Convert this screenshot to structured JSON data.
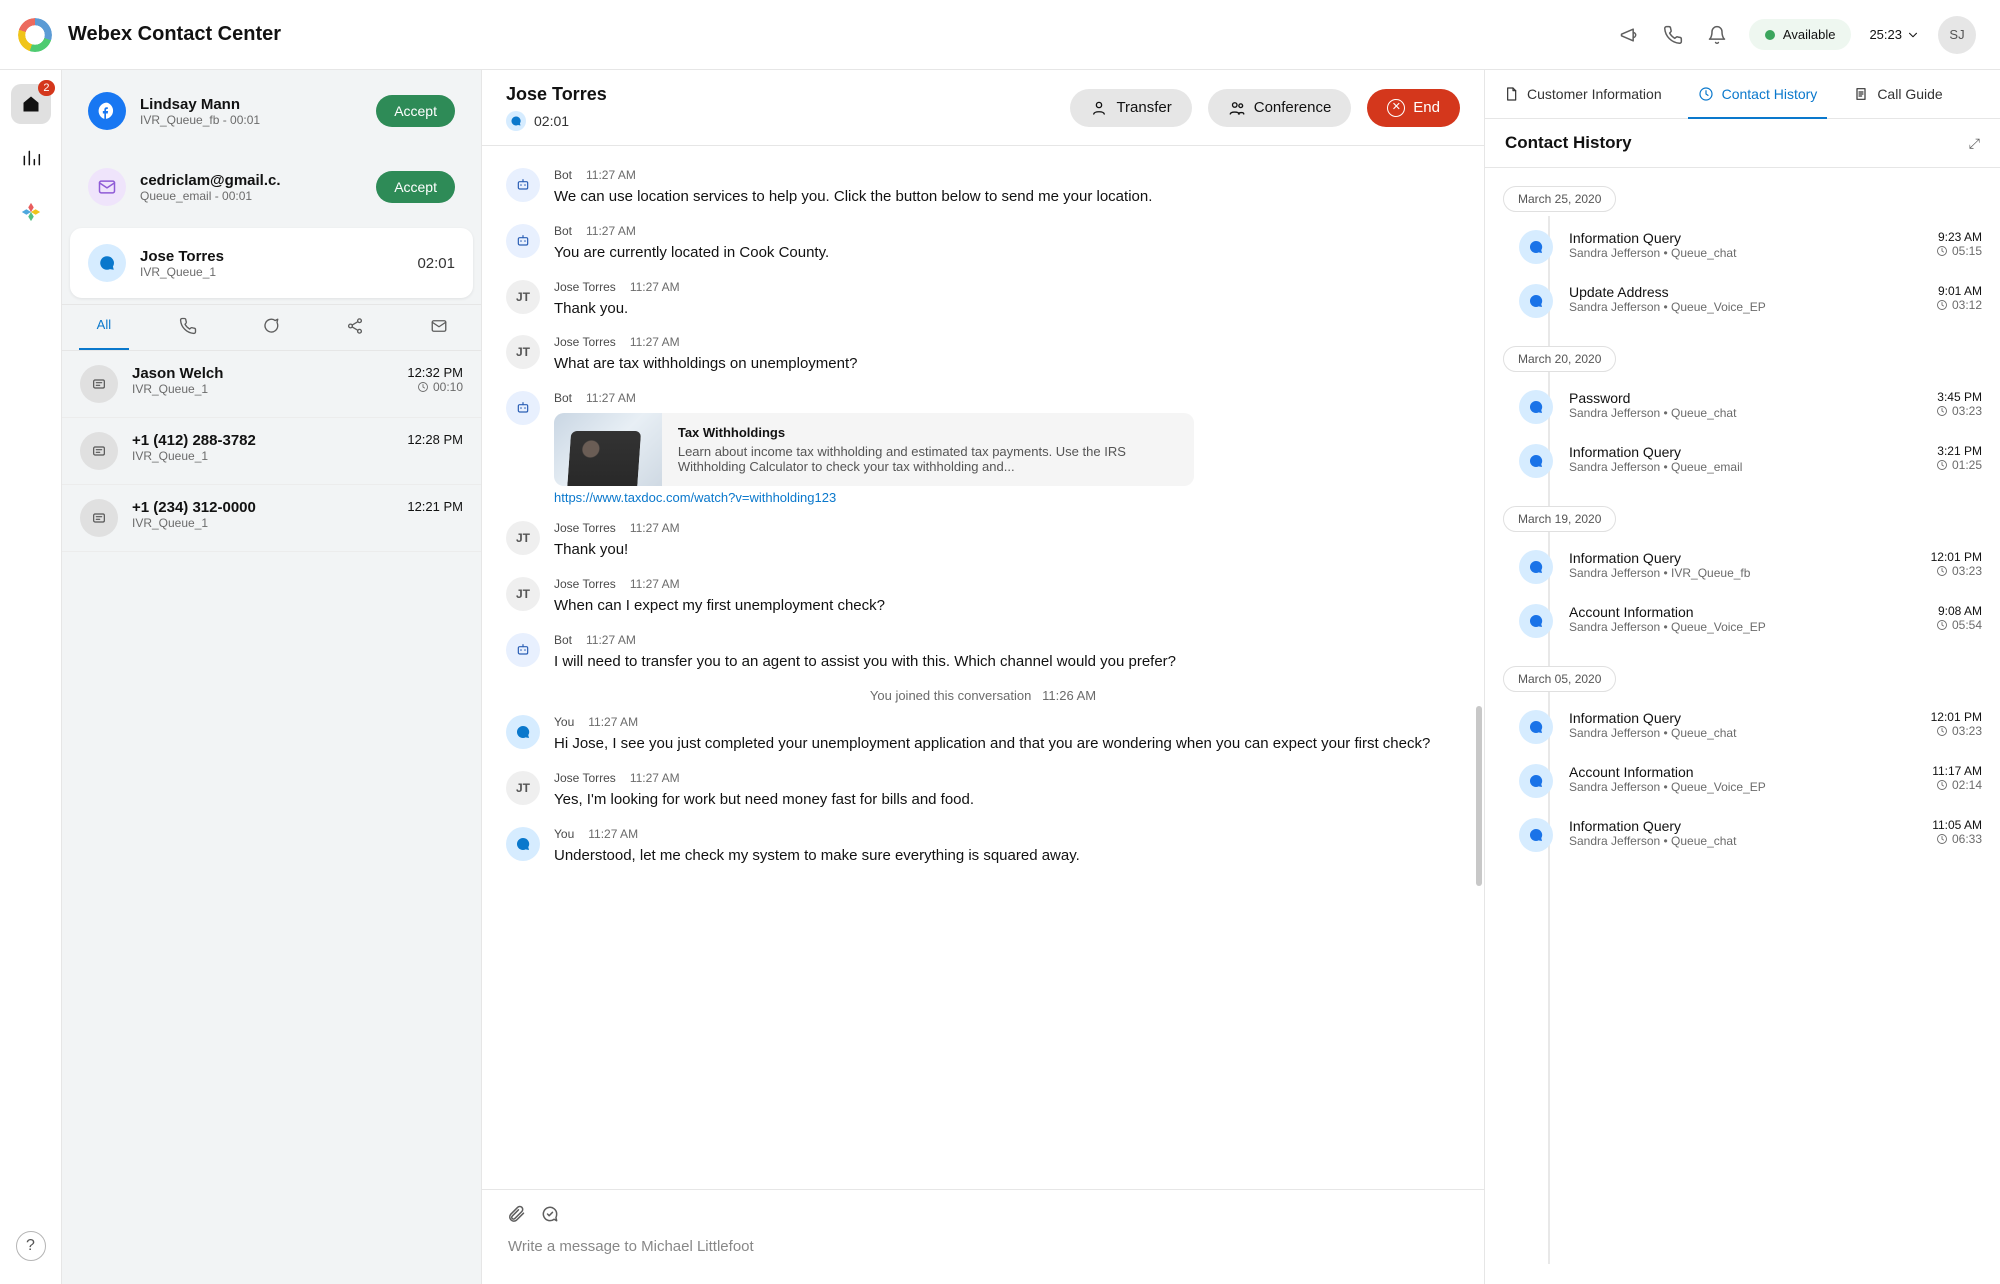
{
  "header": {
    "app_title": "Webex Contact Center",
    "status_label": "Available",
    "session_timer": "25:23",
    "user_initials": "SJ"
  },
  "rail": {
    "home_badge": "2"
  },
  "queue": {
    "items": [
      {
        "name": "Lindsay Mann",
        "sub": "IVR_Queue_fb - 00:01",
        "channel": "fb",
        "action": "Accept"
      },
      {
        "name": "cedriclam@gmail.c.",
        "sub": "Queue_email - 00:01",
        "channel": "email",
        "action": "Accept"
      },
      {
        "name": "Jose Torres",
        "sub": "IVR_Queue_1",
        "channel": "chat",
        "timer": "02:01",
        "selected": true
      }
    ],
    "history_tabs": {
      "active": "All"
    },
    "history": [
      {
        "name": "Jason Welch",
        "sub": "IVR_Queue_1",
        "time": "12:32 PM",
        "dur": "00:10"
      },
      {
        "name": "+1 (412) 288-3782",
        "sub": "IVR_Queue_1",
        "time": "12:28 PM"
      },
      {
        "name": "+1 (234) 312-0000",
        "sub": "IVR_Queue_1",
        "time": "12:21 PM"
      }
    ]
  },
  "conversation": {
    "title": "Jose Torres",
    "timer": "02:01",
    "buttons": {
      "transfer": "Transfer",
      "conference": "Conference",
      "end": "End"
    },
    "compose_placeholder": "Write a message to Michael Littlefoot",
    "system_note_text": "You joined this conversation",
    "system_note_time": "11:26 AM",
    "card": {
      "title": "Tax Withholdings",
      "desc": "Learn about income tax withholding and estimated tax payments. Use the IRS Withholding Calculator to check your tax withholding and...",
      "link": "https://www.taxdoc.com/watch?v=withholding123"
    },
    "messages": [
      {
        "sender": "Bot",
        "time": "11:27 AM",
        "avatar": "bot",
        "text": "We can use location services to help you.  Click the button below to send me your location."
      },
      {
        "sender": "Bot",
        "time": "11:27 AM",
        "avatar": "bot",
        "text": "You are currently located in Cook County."
      },
      {
        "sender": "Jose Torres",
        "time": "11:27 AM",
        "avatar": "jt",
        "text": "Thank you."
      },
      {
        "sender": "Jose Torres",
        "time": "11:27 AM",
        "avatar": "jt",
        "text": "What are tax withholdings on unemployment?"
      },
      {
        "sender": "Bot",
        "time": "11:27 AM",
        "avatar": "bot",
        "card": true
      },
      {
        "sender": "Jose Torres",
        "time": "11:27 AM",
        "avatar": "jt",
        "text": "Thank you!"
      },
      {
        "sender": "Jose Torres",
        "time": "11:27 AM",
        "avatar": "jt",
        "text": "When can I expect my first unemployment check?"
      },
      {
        "sender": "Bot",
        "time": "11:27 AM",
        "avatar": "bot",
        "text": "I will need to transfer you to an agent to assist you with this.  Which channel would you prefer?"
      },
      {
        "system": true
      },
      {
        "sender": "You",
        "time": "11:27 AM",
        "avatar": "you",
        "text": "Hi Jose, I see you just completed your unemployment application and that you are wondering when you can expect your first check?"
      },
      {
        "sender": "Jose Torres",
        "time": "11:27 AM",
        "avatar": "jt",
        "text": "Yes, I'm looking for work but need money fast for bills and food."
      },
      {
        "sender": "You",
        "time": "11:27 AM",
        "avatar": "you",
        "text": "Understood, let me check my system to make sure everything is squared away."
      }
    ]
  },
  "info": {
    "tabs": {
      "customer": "Customer Information",
      "history": "Contact History",
      "guide": "Call Guide"
    },
    "panel_title": "Contact History",
    "groups": [
      {
        "date": "March 25, 2020",
        "items": [
          {
            "title": "Information Query",
            "sub": "Sandra Jefferson • Queue_chat",
            "time": "9:23 AM",
            "dur": "05:15"
          },
          {
            "title": "Update Address",
            "sub": "Sandra Jefferson • Queue_Voice_EP",
            "time": "9:01 AM",
            "dur": "03:12"
          }
        ]
      },
      {
        "date": "March 20, 2020",
        "items": [
          {
            "title": "Password",
            "sub": "Sandra Jefferson • Queue_chat",
            "time": "3:45 PM",
            "dur": "03:23"
          },
          {
            "title": "Information Query",
            "sub": "Sandra Jefferson • Queue_email",
            "time": "3:21 PM",
            "dur": "01:25"
          }
        ]
      },
      {
        "date": "March 19, 2020",
        "items": [
          {
            "title": "Information Query",
            "sub": "Sandra Jefferson • IVR_Queue_fb",
            "time": "12:01 PM",
            "dur": "03:23"
          },
          {
            "title": "Account Information",
            "sub": "Sandra Jefferson • Queue_Voice_EP",
            "time": "9:08 AM",
            "dur": "05:54"
          }
        ]
      },
      {
        "date": "March 05, 2020",
        "items": [
          {
            "title": "Information Query",
            "sub": "Sandra Jefferson • Queue_chat",
            "time": "12:01 PM",
            "dur": "03:23"
          },
          {
            "title": "Account Information",
            "sub": "Sandra Jefferson • Queue_Voice_EP",
            "time": "11:17 AM",
            "dur": "02:14"
          },
          {
            "title": "Information Query",
            "sub": "Sandra Jefferson • Queue_chat",
            "time": "11:05 AM",
            "dur": "06:33"
          }
        ]
      }
    ]
  }
}
